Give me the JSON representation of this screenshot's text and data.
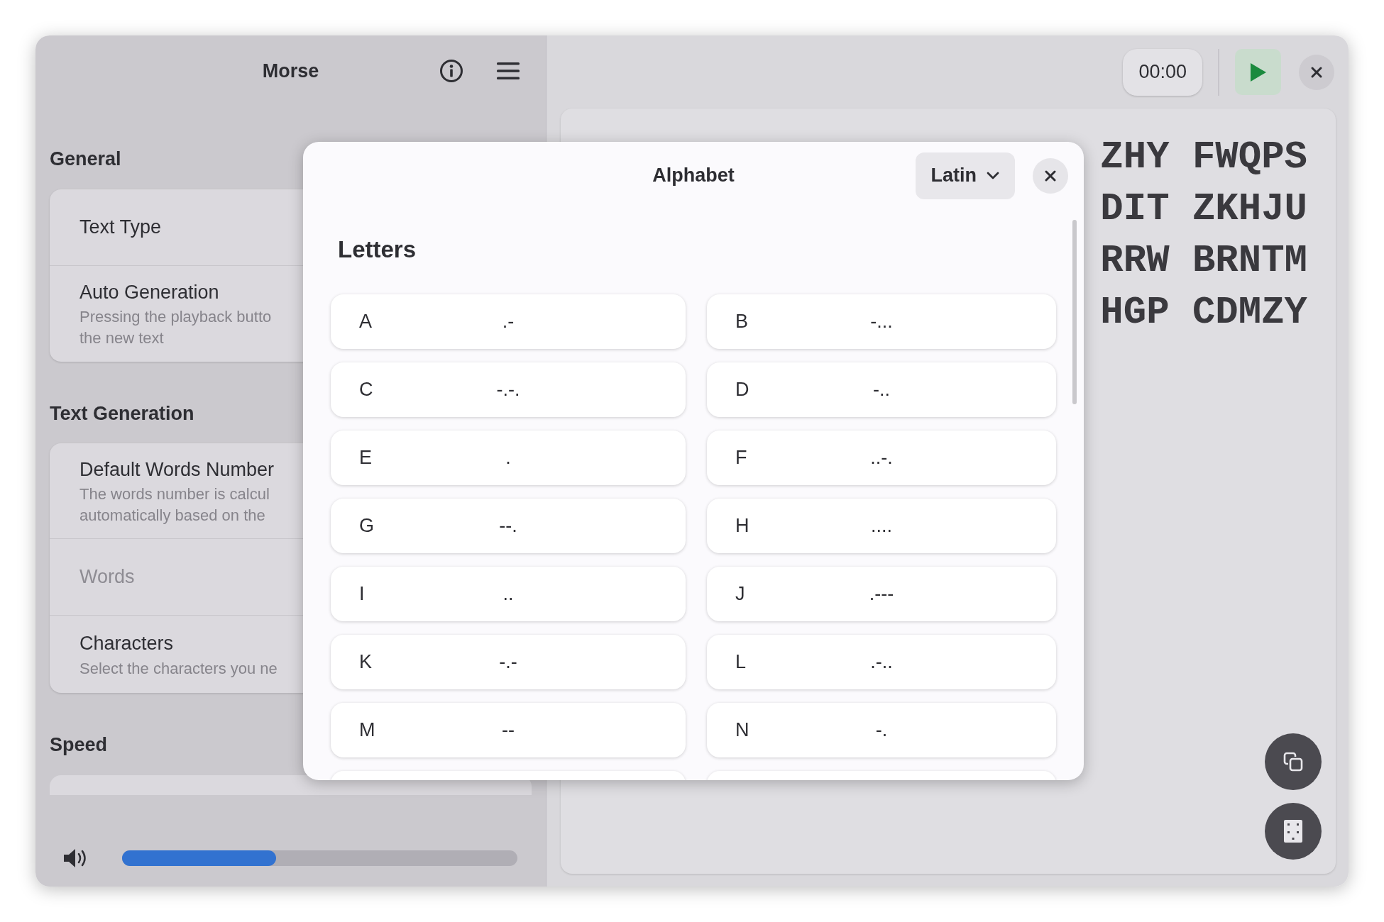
{
  "sidebar": {
    "title": "Morse",
    "sections": [
      {
        "heading": "General",
        "kind": "list",
        "rows": [
          {
            "title": "Text Type",
            "disabled": false
          },
          {
            "title": "Auto Generation",
            "subtitle_lines": [
              "Pressing the playback butto",
              "the new text"
            ],
            "disabled": false
          }
        ]
      },
      {
        "heading": "Text Generation",
        "kind": "list",
        "rows": [
          {
            "title": "Default Words Number",
            "subtitle_lines": [
              "The words number is calcul",
              "automatically based on the"
            ],
            "disabled": false
          },
          {
            "title": "Words",
            "disabled": true
          },
          {
            "title": "Characters",
            "subtitle_lines": [
              "Select the characters you ne"
            ],
            "disabled": false
          }
        ]
      },
      {
        "heading": "Speed",
        "kind": "clipped"
      }
    ],
    "volume": {
      "level": 0.39
    }
  },
  "player": {
    "timer": "00:00"
  },
  "practice_text": [
    "ZHY FWQPS",
    "DIT ZKHJU",
    "RRW BRNTM",
    "HGP CDMZY"
  ],
  "dialog": {
    "title": "Alphabet",
    "script": "Latin",
    "section": "Letters",
    "letters": [
      {
        "letter": "A",
        "code": ".-"
      },
      {
        "letter": "B",
        "code": "-..."
      },
      {
        "letter": "C",
        "code": "-.-."
      },
      {
        "letter": "D",
        "code": "-.."
      },
      {
        "letter": "E",
        "code": "."
      },
      {
        "letter": "F",
        "code": "..-."
      },
      {
        "letter": "G",
        "code": "--."
      },
      {
        "letter": "H",
        "code": "...."
      },
      {
        "letter": "I",
        "code": ".."
      },
      {
        "letter": "J",
        "code": ".---"
      },
      {
        "letter": "K",
        "code": "-.-"
      },
      {
        "letter": "L",
        "code": ".-.."
      },
      {
        "letter": "M",
        "code": "--"
      },
      {
        "letter": "N",
        "code": "-."
      }
    ]
  }
}
